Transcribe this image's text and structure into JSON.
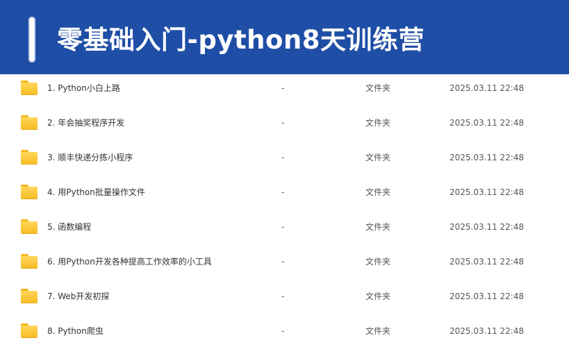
{
  "banner": {
    "title": "零基础入门-python8天训练营"
  },
  "files": [
    {
      "name": "1. Python小白上路",
      "size": "-",
      "type": "文件夹",
      "date": "2025.03.11 22:48",
      "icon": "folder-icon"
    },
    {
      "name": "2. 年会抽奖程序开发",
      "size": "-",
      "type": "文件夹",
      "date": "2025.03.11 22:48",
      "icon": "folder-icon"
    },
    {
      "name": "3. 顺丰快递分拣小程序",
      "size": "-",
      "type": "文件夹",
      "date": "2025.03.11 22:48",
      "icon": "folder-icon"
    },
    {
      "name": "4. 用Python批量操作文件",
      "size": "-",
      "type": "文件夹",
      "date": "2025.03.11 22:48",
      "icon": "folder-icon"
    },
    {
      "name": "5. 函数编程",
      "size": "-",
      "type": "文件夹",
      "date": "2025.03.11 22:48",
      "icon": "folder-icon"
    },
    {
      "name": "6. 用Python开发各种提高工作效率的小工具",
      "size": "-",
      "type": "文件夹",
      "date": "2025.03.11 22:48",
      "icon": "folder-icon"
    },
    {
      "name": "7. Web开发初探",
      "size": "-",
      "type": "文件夹",
      "date": "2025.03.11 22:48",
      "icon": "folder-icon"
    },
    {
      "name": "8. Python爬虫",
      "size": "-",
      "type": "文件夹",
      "date": "2025.03.11 22:48",
      "icon": "folder-icon"
    }
  ],
  "colors": {
    "banner_bg": "#1f4ea6",
    "folder": "#f7be25"
  }
}
